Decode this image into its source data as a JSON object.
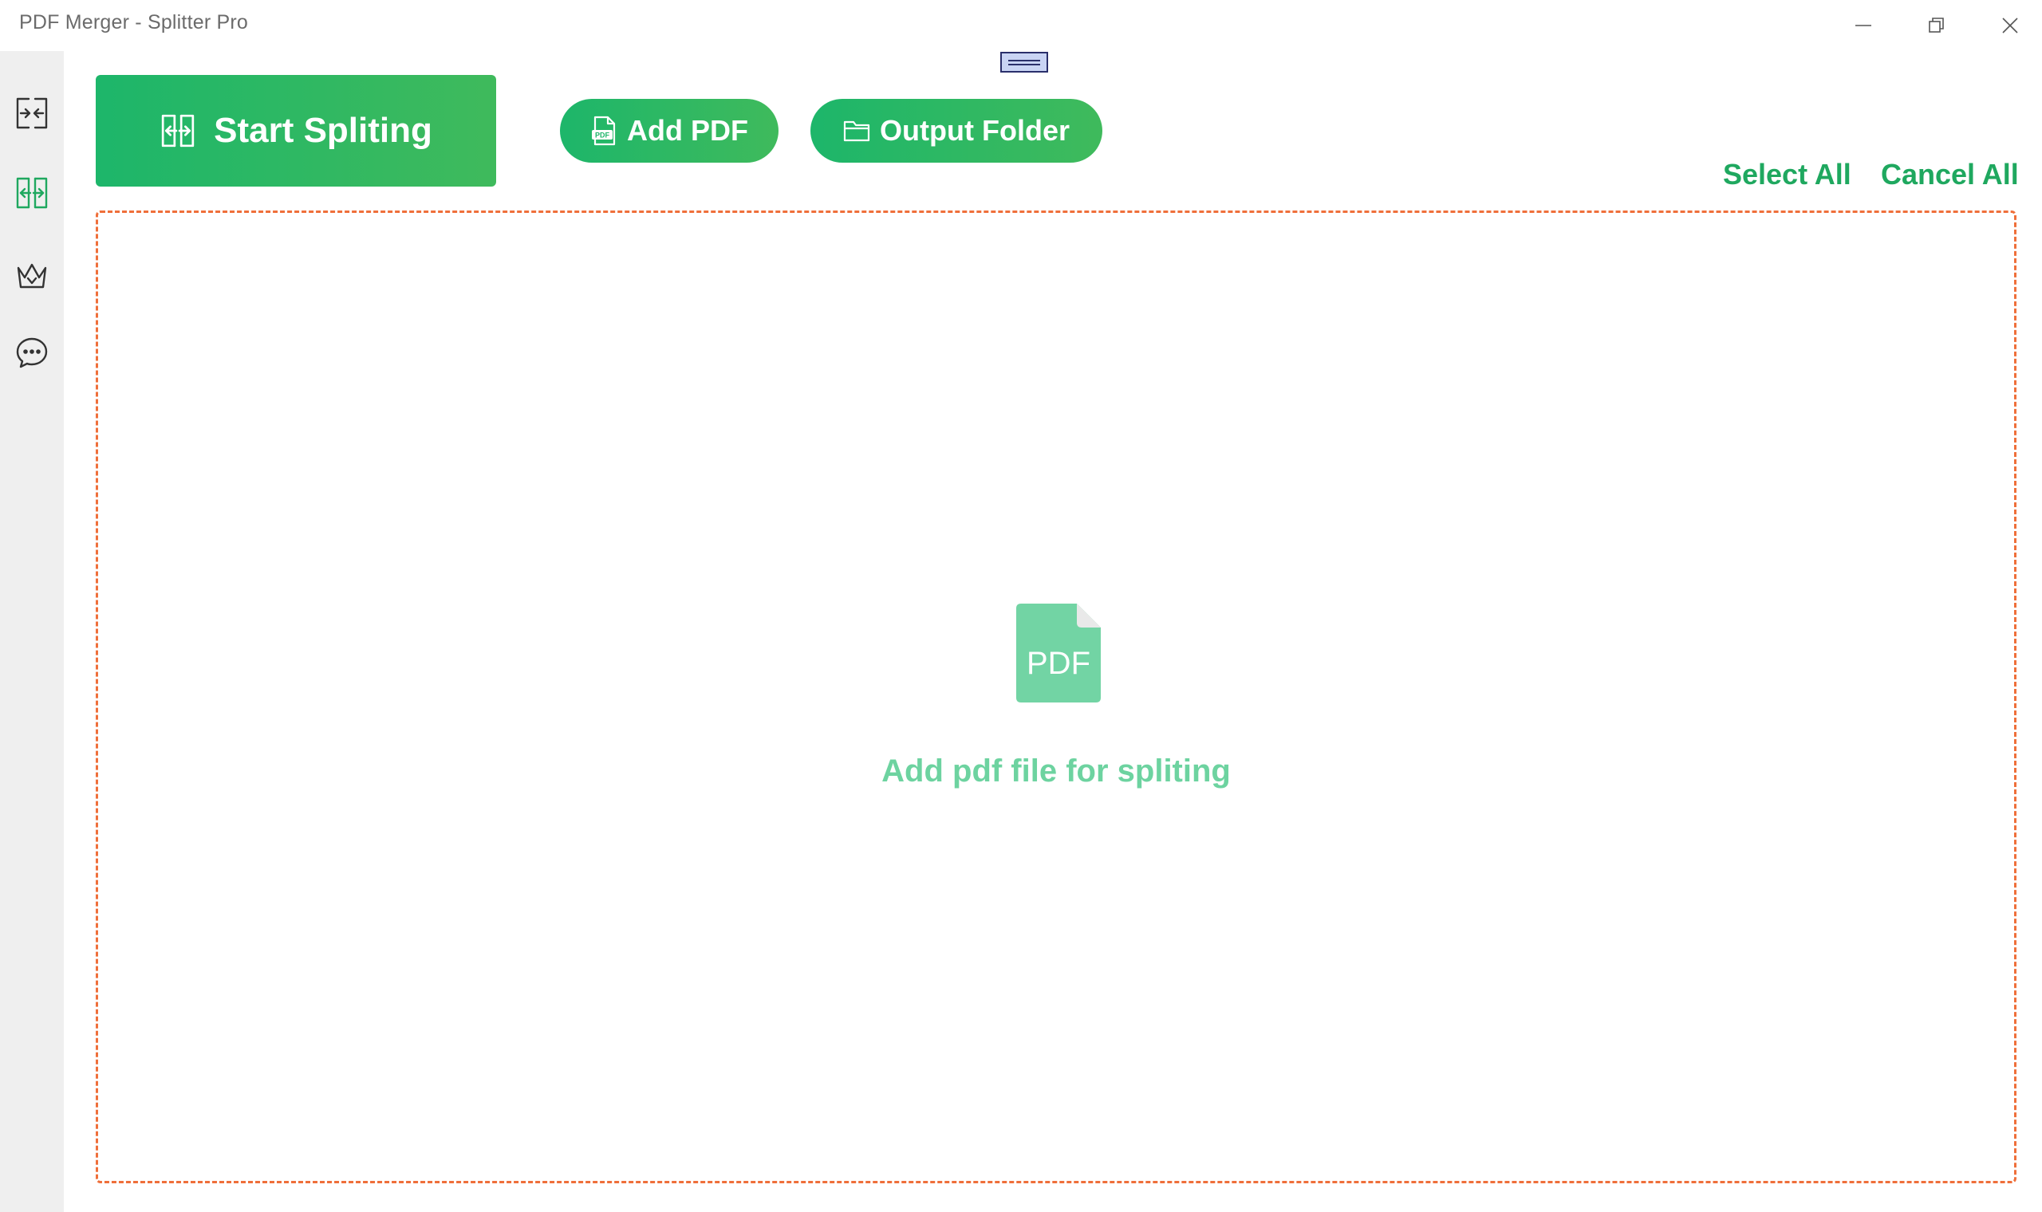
{
  "window": {
    "title": "PDF Merger - Splitter Pro"
  },
  "sidebar": {
    "items": [
      {
        "icon": "merge-icon",
        "active": false
      },
      {
        "icon": "split-icon",
        "active": true
      },
      {
        "icon": "crown-icon",
        "active": false
      },
      {
        "icon": "chat-icon",
        "active": false
      }
    ]
  },
  "toolbar": {
    "start_label": "Start Spliting",
    "add_pdf_label": "Add PDF",
    "output_folder_label": "Output Folder",
    "select_all_label": "Select All",
    "cancel_all_label": "Cancel All"
  },
  "dropzone": {
    "icon_text": "PDF",
    "hint": "Add pdf file for spliting"
  },
  "colors": {
    "accent": "#1fa85f",
    "button_gradient_start": "#1db66a",
    "button_gradient_end": "#3fba5c",
    "hint_text": "#6dd3a0",
    "pdf_icon": "#72d4a4",
    "sidebar_bg": "#efefef",
    "dropzone_border": "#ef6f3a"
  }
}
